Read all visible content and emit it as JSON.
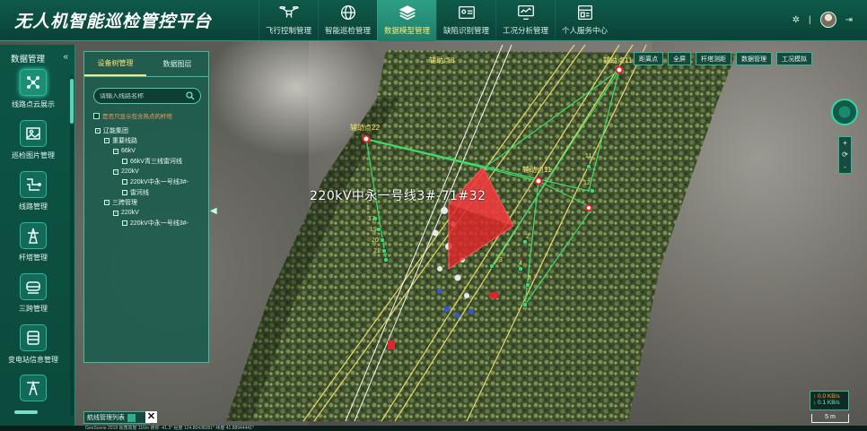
{
  "header": {
    "title": "无人机智能巡检管控平台",
    "nav": [
      {
        "label": "飞行控制管理",
        "icon": "drone-icon"
      },
      {
        "label": "智能巡检管理",
        "icon": "globe-icon"
      },
      {
        "label": "数据模型管理",
        "icon": "layers-icon",
        "active": true
      },
      {
        "label": "缺陷识别管理",
        "icon": "id-card-icon"
      },
      {
        "label": "工况分析管理",
        "icon": "monitor-chart-icon"
      },
      {
        "label": "个人服务中心",
        "icon": "dashboard-icon"
      }
    ],
    "separator": "|"
  },
  "side": {
    "title": "数据管理",
    "collapse": "«",
    "items": [
      {
        "label": "线路点云展示",
        "icon": "point-cloud-icon",
        "active": true
      },
      {
        "label": "巡检图片管理",
        "icon": "photo-icon"
      },
      {
        "label": "线路管理",
        "icon": "circuit-icon"
      },
      {
        "label": "杆塔管理",
        "icon": "tower-icon"
      },
      {
        "label": "三跨管理",
        "icon": "train-icon"
      },
      {
        "label": "变电站信息管理",
        "icon": "substation-icon"
      }
    ]
  },
  "tree_panel": {
    "tabs": [
      "设备树管理",
      "数据图层"
    ],
    "search_placeholder": "请输入线路名称",
    "checkbox_label": "是否只显示包含热点的杆塔",
    "tree": [
      {
        "level": 0,
        "label": "辽能集团",
        "toggle": "-"
      },
      {
        "level": 1,
        "label": "重要线路",
        "toggle": "-"
      },
      {
        "level": 2,
        "label": "66kV",
        "toggle": "-"
      },
      {
        "level": 3,
        "label": "66kV青三线雷河线",
        "toggle": ""
      },
      {
        "level": 2,
        "label": "220kV",
        "toggle": "-"
      },
      {
        "level": 3,
        "label": "220kV中永一号线3#-",
        "toggle": ""
      },
      {
        "level": 3,
        "label": "雷河线",
        "toggle": ""
      },
      {
        "level": 1,
        "label": "三跨管理",
        "toggle": "-"
      },
      {
        "level": 2,
        "label": "220kV",
        "toggle": "-"
      },
      {
        "level": 3,
        "label": "220kV中永一号线3#-",
        "toggle": ""
      }
    ]
  },
  "toolbar": [
    "距离点",
    "全屏",
    "杆塔测距",
    "数据管理",
    "工况模拟"
  ],
  "map": {
    "line_label": "220kV中永一号线3#-71#32",
    "tower_labels": [
      "辅助点22",
      "辅助点11",
      "辅助点11",
      "辅助点8"
    ],
    "zoom_in": "+",
    "zoom_reset": "⟳",
    "zoom_out": "-"
  },
  "speed": {
    "up": "↑ 0.0 KB/s",
    "down": "↓ 0.1 KB/s"
  },
  "scale": "5 m",
  "dock": {
    "label": "航线管理列表"
  },
  "status": "GeoScene 2019    视角高度 116m    俯仰 -41.3°    经度 124.80438281°    纬度 41.88944441°",
  "colors": {
    "accent": "#21a387",
    "active_nav": "#2d9f84",
    "highlight": "#ffe27a",
    "danger": "#e2242a",
    "measure": "#3ddc6a"
  }
}
